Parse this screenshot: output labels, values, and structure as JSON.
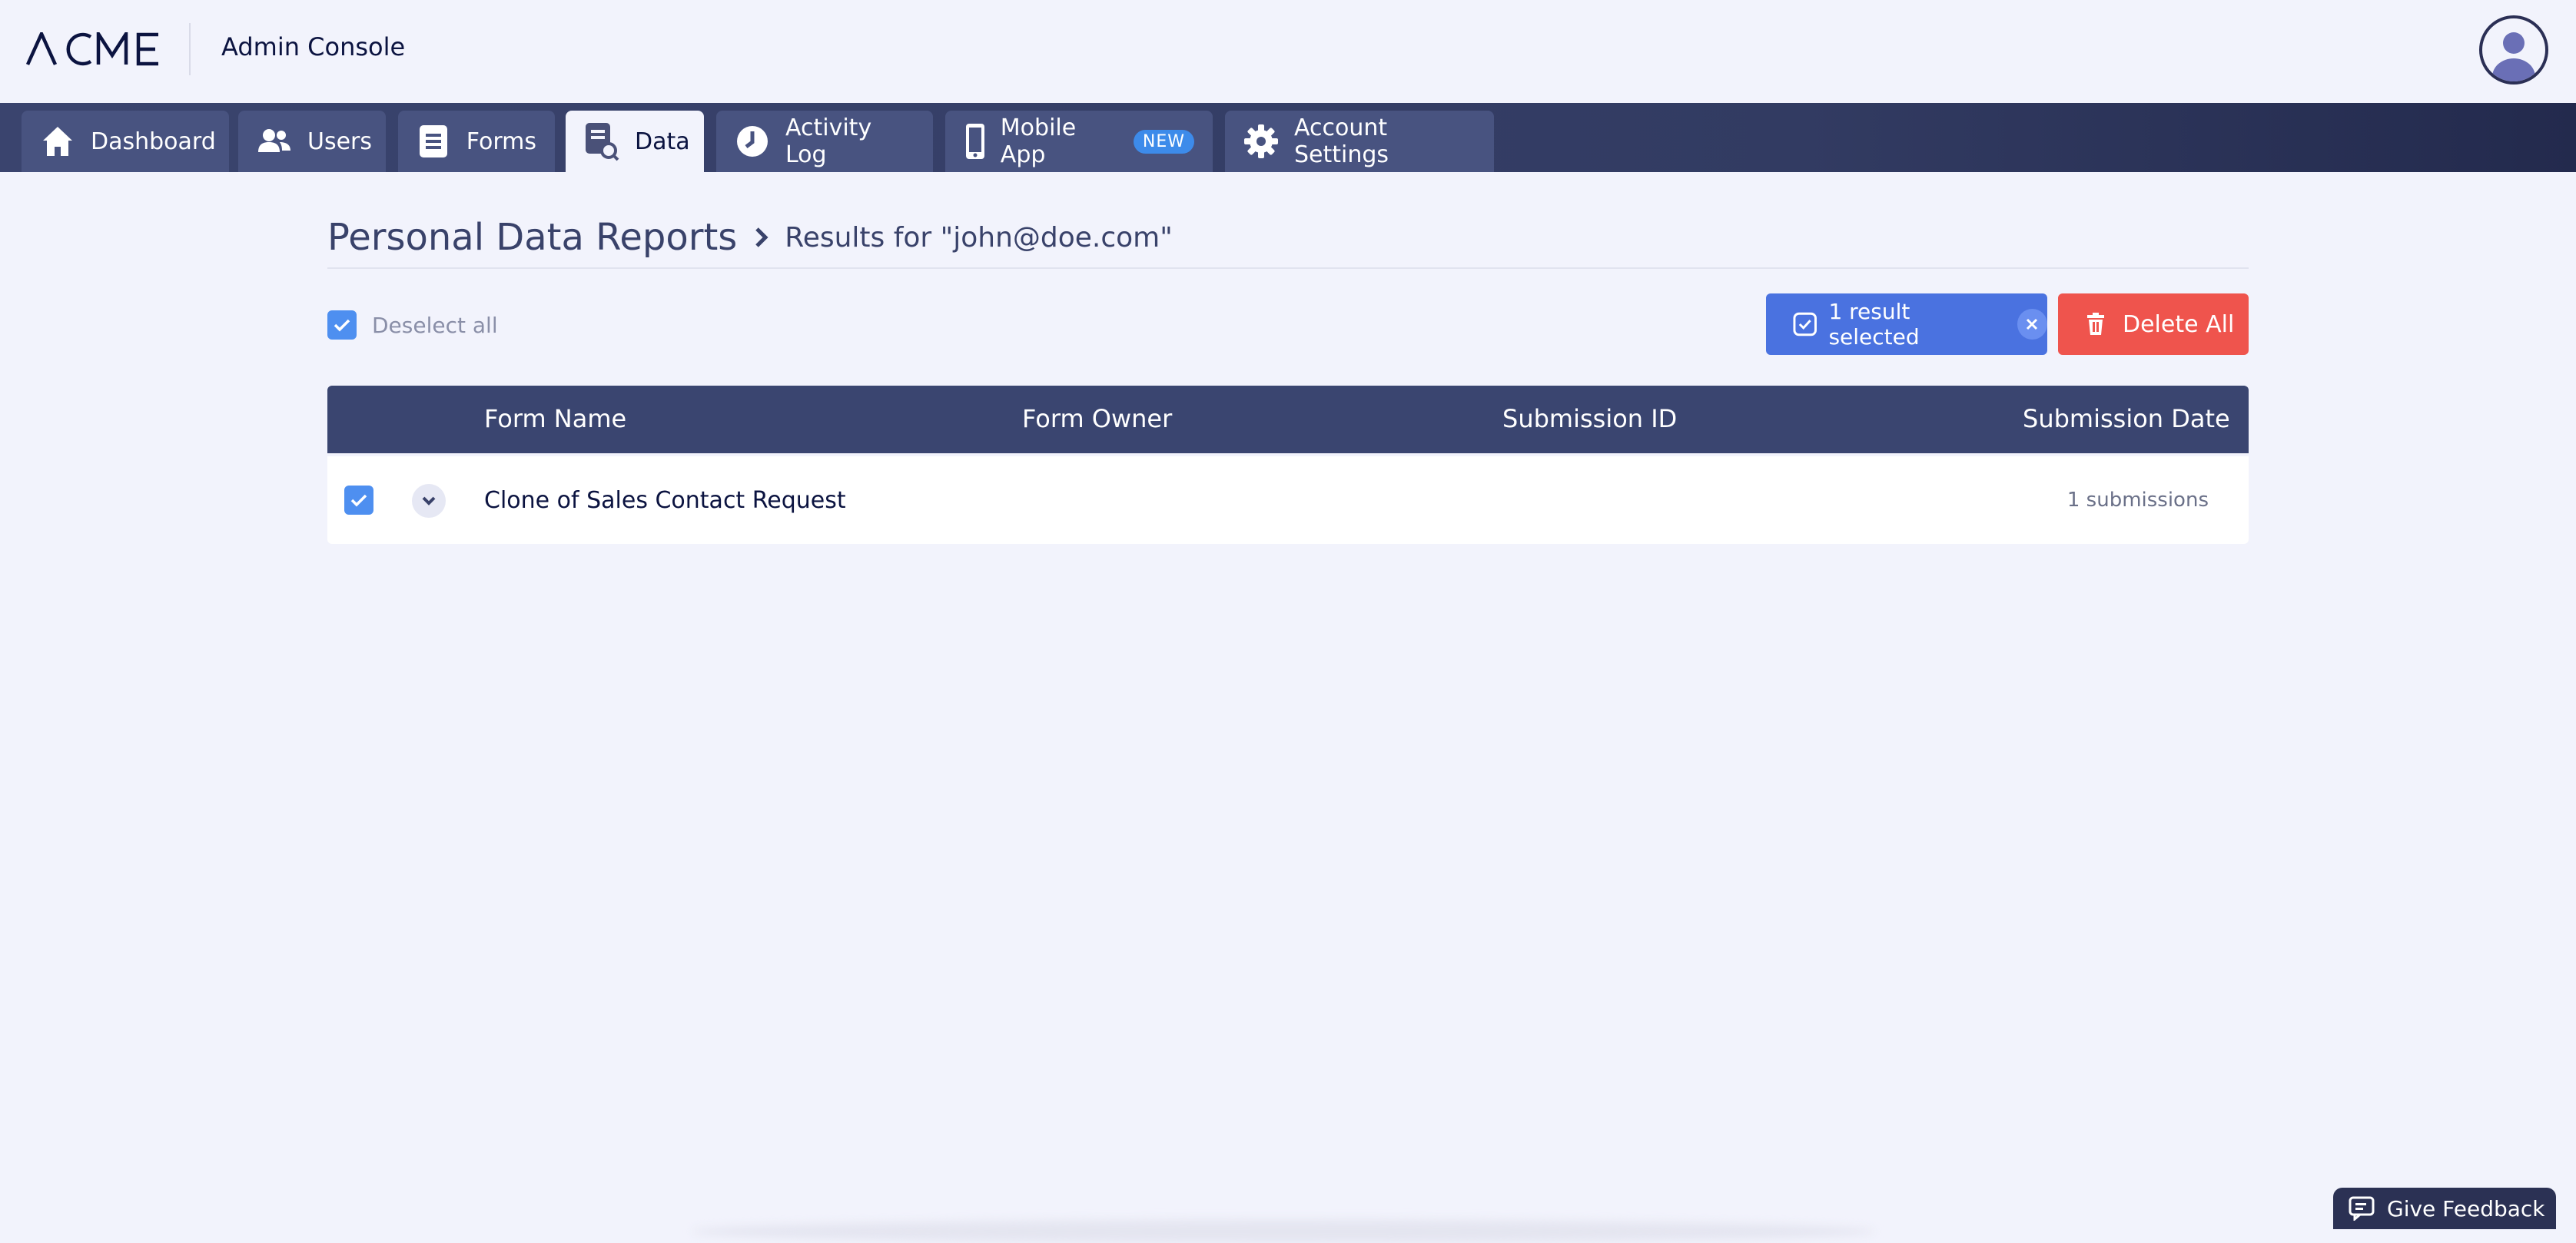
{
  "header": {
    "logo_text": "ACME",
    "app_title": "Admin Console"
  },
  "nav": {
    "tabs": [
      {
        "label": "Dashboard",
        "icon": "home-icon"
      },
      {
        "label": "Users",
        "icon": "users-icon"
      },
      {
        "label": "Forms",
        "icon": "forms-icon"
      },
      {
        "label": "Data",
        "icon": "data-search-icon",
        "active": true
      },
      {
        "label": "Activity Log",
        "icon": "clock-icon"
      },
      {
        "label": "Mobile App",
        "icon": "mobile-icon",
        "badge": "NEW"
      },
      {
        "label": "Account Settings",
        "icon": "gear-icon"
      }
    ]
  },
  "page": {
    "title": "Personal Data Reports",
    "breadcrumb": "Results for \"john@doe.com\""
  },
  "selection": {
    "deselect_label": "Deselect all",
    "selected_label": "1 result selected",
    "delete_label": "Delete All"
  },
  "table": {
    "columns": [
      "Form Name",
      "Form Owner",
      "Submission ID",
      "Submission Date"
    ],
    "rows": [
      {
        "form_name": "Clone of Sales Contact Request",
        "count": "1 submissions",
        "checked": true
      }
    ]
  },
  "feedback": {
    "label": "Give Feedback"
  },
  "colors": {
    "nav_bg": "#3a446e",
    "accent_blue": "#4a72e0",
    "danger_red": "#ef544d",
    "badge_blue": "#3d8bea"
  }
}
